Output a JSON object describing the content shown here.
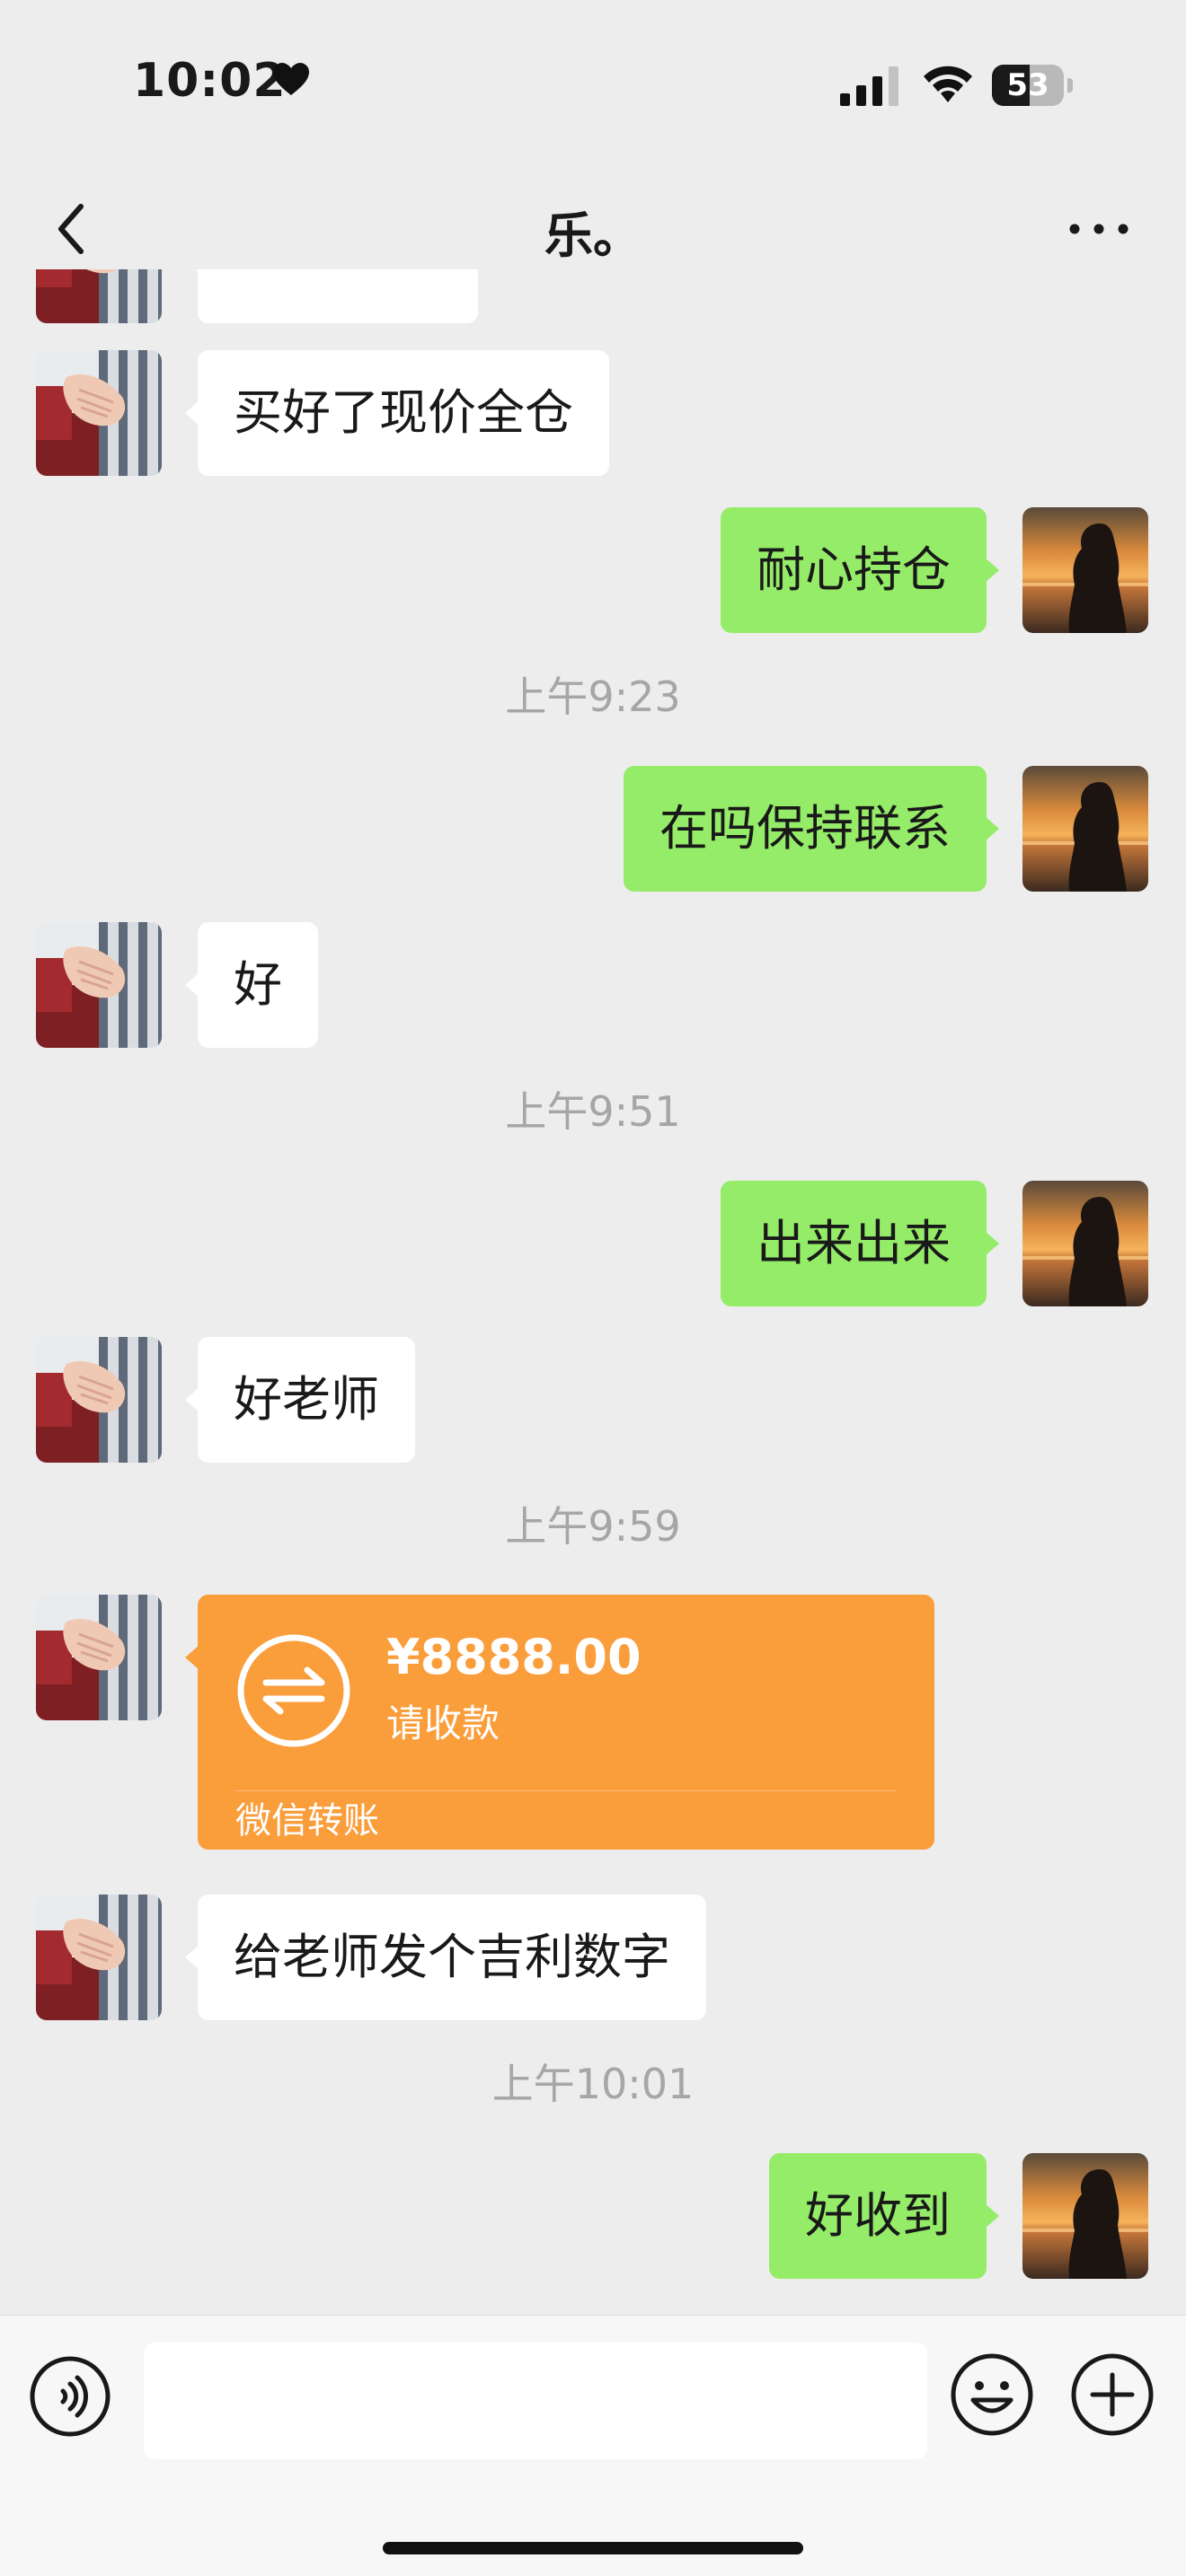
{
  "status_bar": {
    "time": "10:02",
    "battery_percent": "53",
    "battery_level": 0.53
  },
  "header": {
    "title": "乐。"
  },
  "colors": {
    "background": "#ededed",
    "incoming_bubble": "#ffffff",
    "outgoing_bubble": "#95ec69",
    "transfer_card": "#fa9d3b",
    "timestamp_text": "#a6a6a6"
  },
  "messages": [
    {
      "type": "text",
      "side": "left",
      "text": "买好了现价全仓"
    },
    {
      "type": "text",
      "side": "right",
      "text": "耐心持仓"
    },
    {
      "type": "time",
      "text": "上午9:23"
    },
    {
      "type": "text",
      "side": "right",
      "text": "在吗保持联系"
    },
    {
      "type": "text",
      "side": "left",
      "text": "好"
    },
    {
      "type": "time",
      "text": "上午9:51"
    },
    {
      "type": "text",
      "side": "right",
      "text": "出来出来"
    },
    {
      "type": "text",
      "side": "left",
      "text": "好老师"
    },
    {
      "type": "time",
      "text": "上午9:59"
    },
    {
      "type": "transfer",
      "side": "left",
      "amount": "¥8888.00",
      "status": "请收款",
      "label": "微信转账"
    },
    {
      "type": "text",
      "side": "left",
      "text": "给老师发个吉利数字"
    },
    {
      "type": "time",
      "text": "上午10:01"
    },
    {
      "type": "text",
      "side": "right",
      "text": "好收到"
    }
  ],
  "input": {
    "value": "",
    "placeholder": ""
  },
  "icons": {
    "back": "chevron-left-icon",
    "more": "more-dots-icon",
    "voice": "voice-icon",
    "emoji": "emoji-icon",
    "add": "plus-circle-icon",
    "transfer": "transfer-arrows-icon"
  }
}
